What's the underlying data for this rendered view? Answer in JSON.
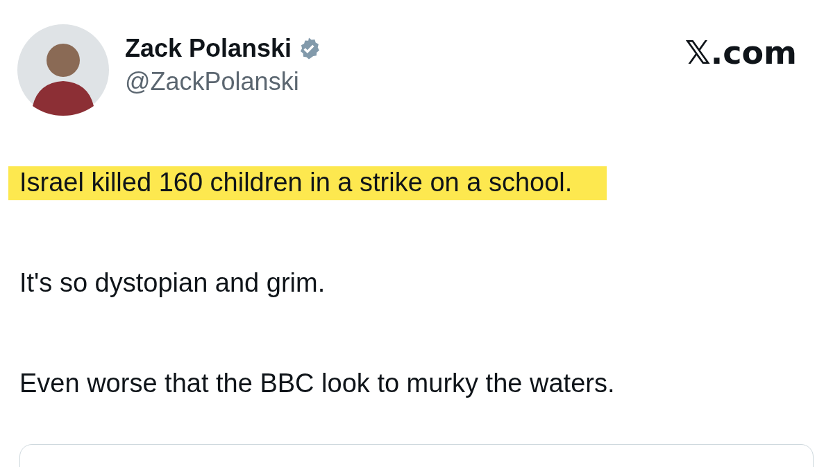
{
  "author": {
    "name": "Zack Polanski",
    "verified": true,
    "handle": "@ZackPolanski"
  },
  "site": "𝕏.com",
  "paragraphs": [
    {
      "text": "Israel killed 160 children in a strike on a school.",
      "highlighted": true
    },
    {
      "text": "It's so dystopian and grim.",
      "highlighted": false
    },
    {
      "text": "Even worse that the BBC look to murky the waters.",
      "highlighted": false
    }
  ],
  "embedded_card": {
    "kind": "card"
  }
}
